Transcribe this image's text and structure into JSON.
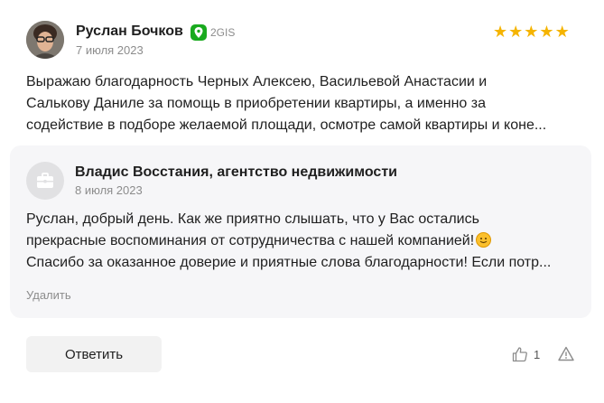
{
  "review": {
    "author": "Руслан Бочков",
    "source": "2GIS",
    "date": "7 июля 2023",
    "rating": 5,
    "text_lines": [
      "Выражаю благодарность Черных Алексею, Васильевой Анастасии и",
      "Салькову Даниле за помощь в приобретении квартиры, а именно за",
      "содействие в подборе желаемой площади, осмотре самой квартиры и коне..."
    ]
  },
  "reply": {
    "author": "Владис Восстания, агентство недвижимости",
    "date": "8 июля 2023",
    "text_lines": [
      "Руслан, добрый день. Как же приятно слышать, что у Вас остались",
      "прекрасные воспоминания от сотрудничества с нашей компанией!",
      "Спасибо за оказанное доверие и приятные слова благодарности! Если потр..."
    ],
    "delete_label": "Удалить"
  },
  "actions": {
    "answer_label": "Ответить",
    "like_count": "1"
  },
  "colors": {
    "star": "#f5b400",
    "source_badge": "#19aa1e",
    "reply_bg": "#f6f6f8"
  },
  "icons": [
    "2gis-icon",
    "star-icon",
    "briefcase-icon",
    "smile-emoji-icon",
    "thumbs-up-icon",
    "warning-icon"
  ]
}
